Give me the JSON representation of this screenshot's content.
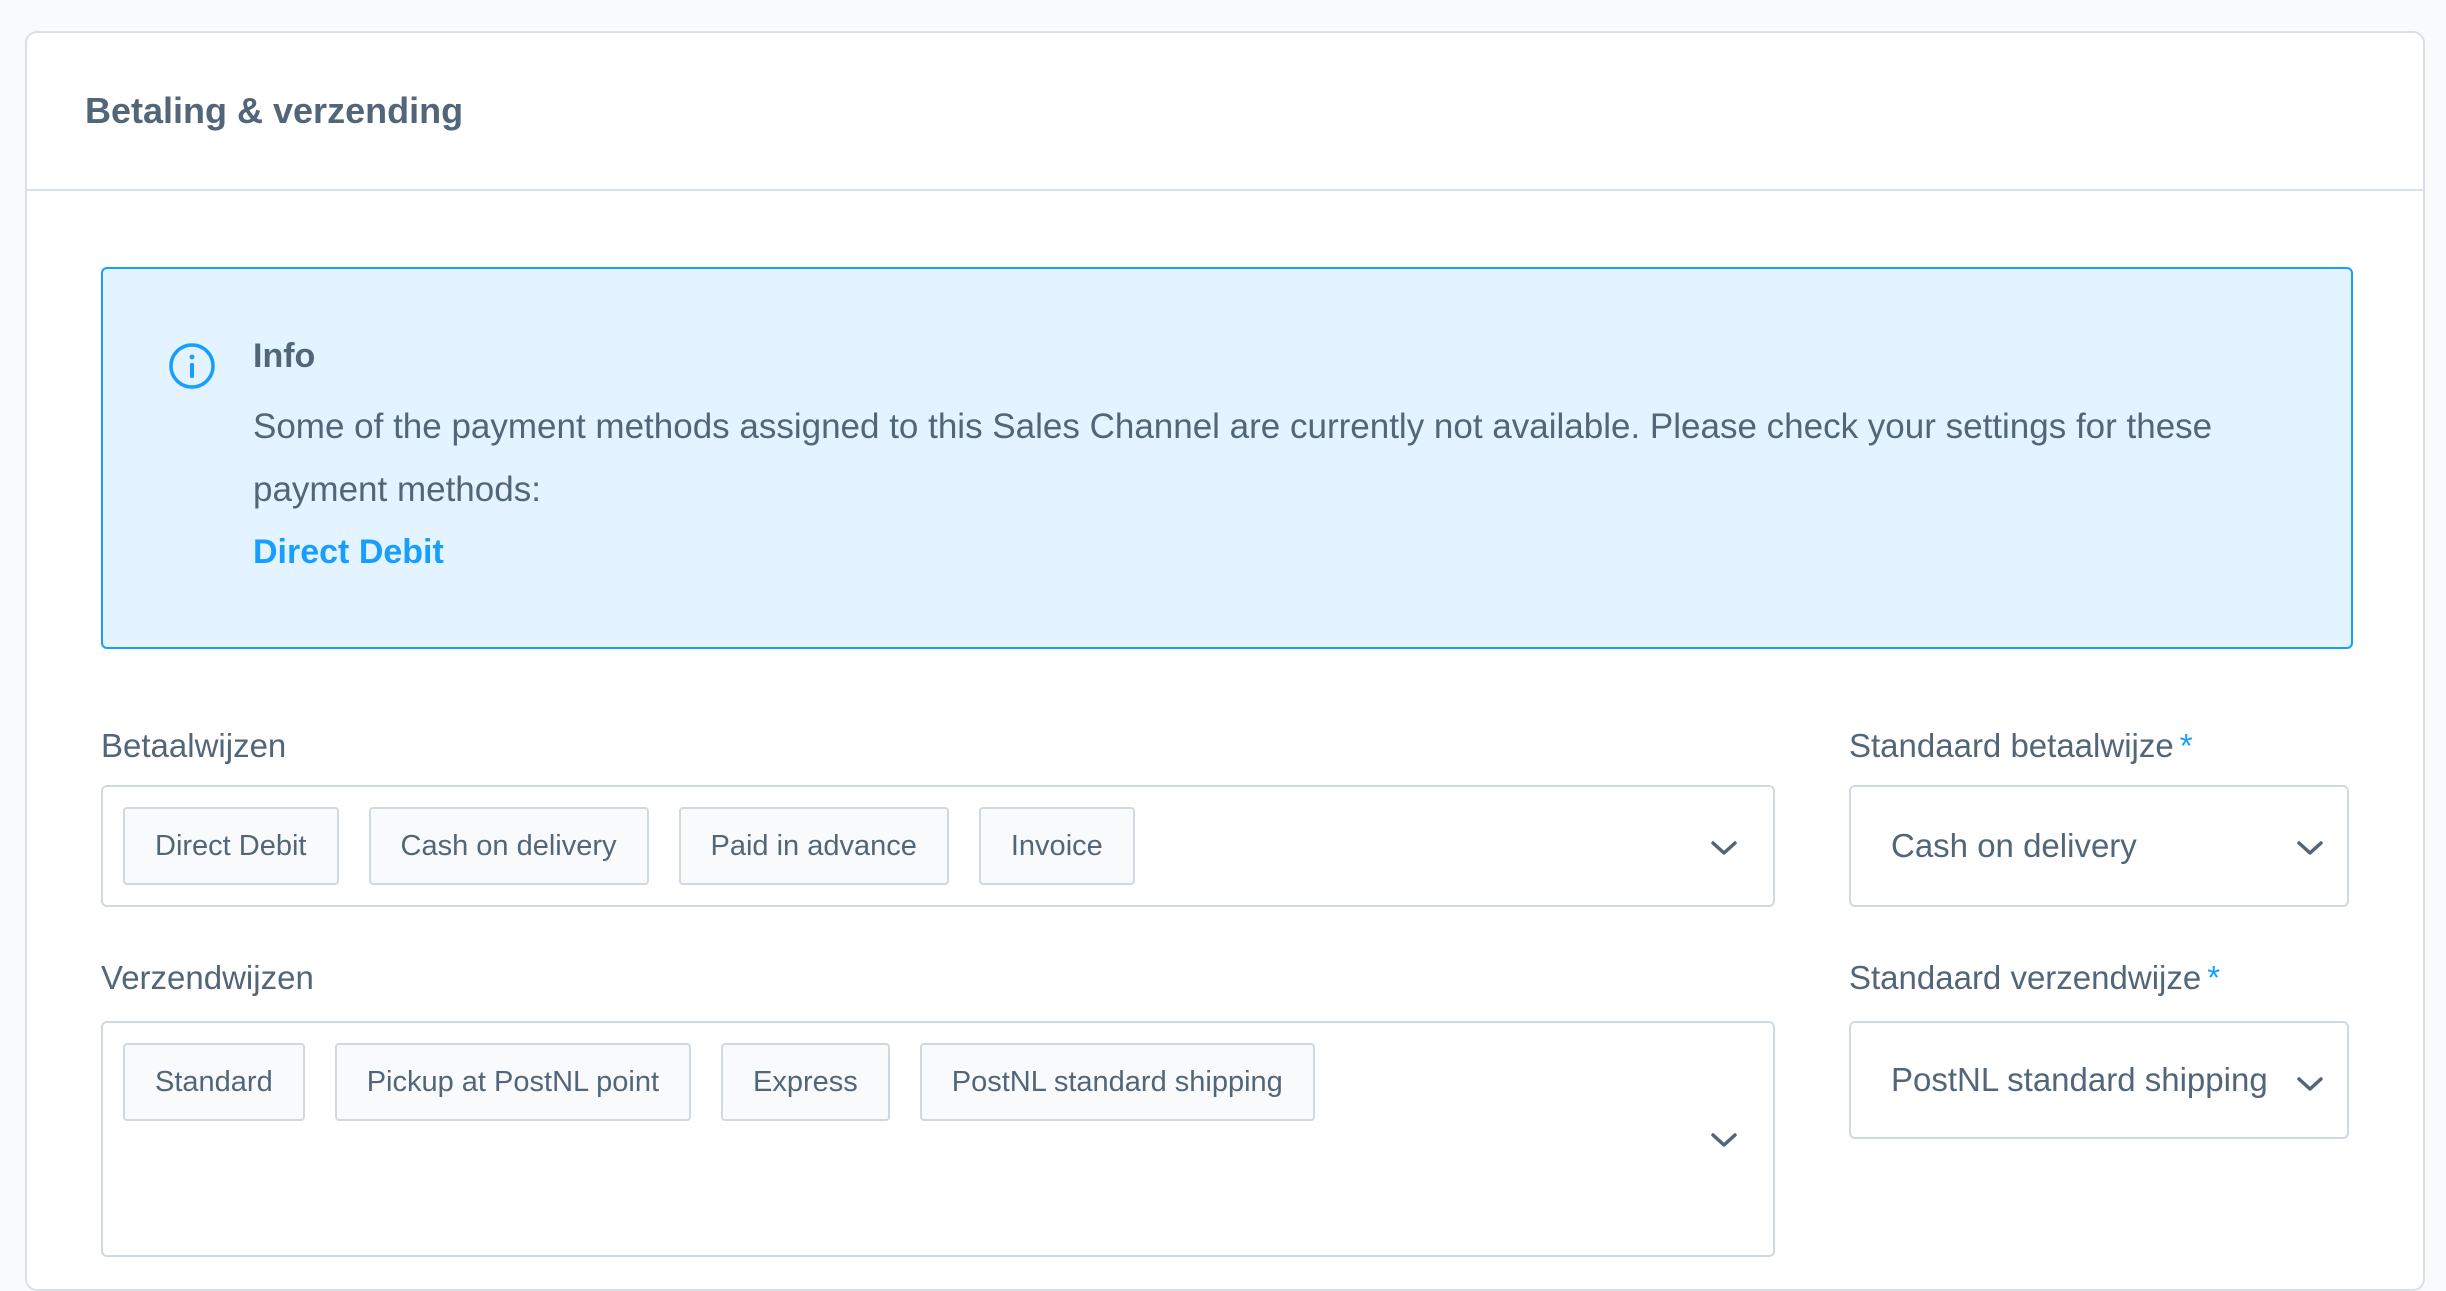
{
  "card": {
    "title": "Betaling & verzending"
  },
  "alert": {
    "icon": "info-icon",
    "title": "Info",
    "message": "Some of the payment methods assigned to this Sales Channel are currently not available. Please check your settings for these payment methods:",
    "link": "Direct Debit",
    "colors": {
      "border": "#189eff",
      "background": "#e3f3ff",
      "link": "#189eff"
    }
  },
  "payment_methods": {
    "label": "Betaalwijzen",
    "tags": [
      "Direct Debit",
      "Cash on delivery",
      "Paid in advance",
      "Invoice"
    ],
    "icon": "chevron-down-icon"
  },
  "default_payment": {
    "label": "Standaard betaalwijze",
    "required_marker": "*",
    "value": "Cash on delivery",
    "icon": "chevron-down-icon"
  },
  "shipping_methods": {
    "label": "Verzendwijzen",
    "tags": [
      "Standard",
      "Pickup at PostNL point",
      "Express",
      "PostNL standard shipping"
    ],
    "icon": "chevron-down-icon"
  },
  "default_shipping": {
    "label": "Standaard verzendwijze",
    "required_marker": "*",
    "value": "PostNL standard shipping",
    "icon": "chevron-down-icon"
  }
}
